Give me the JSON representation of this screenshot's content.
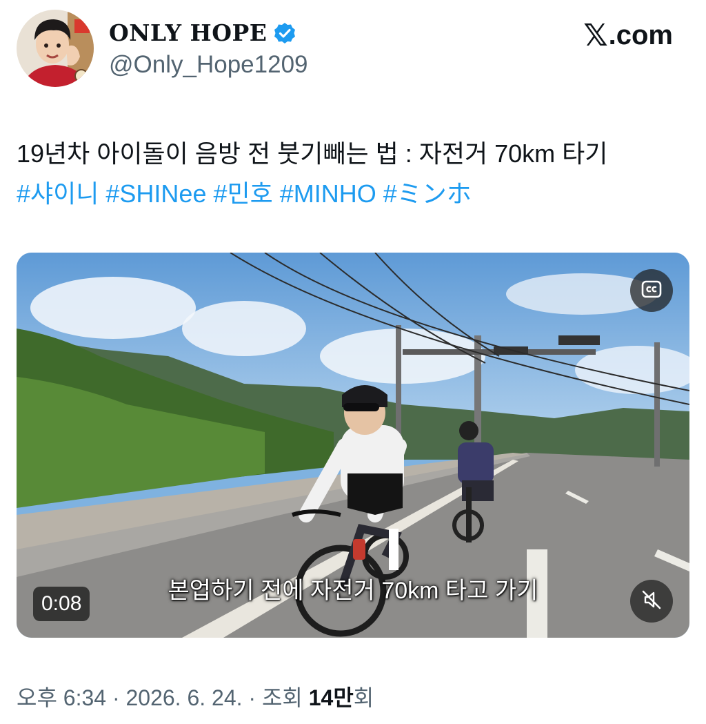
{
  "author": {
    "display_name": "ONLY HOPE",
    "handle": "@Only_Hope1209",
    "avatar_icon": "profile-avatar",
    "verified_icon": "verified-badge-icon"
  },
  "brand": {
    "label": ".com",
    "x_glyph": "𝕏"
  },
  "tweet": {
    "text": "19년차 아이돌이 음방 전 붓기빼는 법 : 자전거 70km 타기",
    "hashtags": [
      "#샤이니",
      "#SHINee",
      "#민호",
      "#MINHO",
      "#ミンホ"
    ]
  },
  "video": {
    "subtitle": "본업하기 전에 자전거 70km 타고 가기",
    "timestamp": "0:08",
    "cc_icon": "closed-captions-icon",
    "mute_icon": "muted-speaker-icon"
  },
  "meta": {
    "prefix": "오후 6:34 · 2026. 6. 24. · 조회 ",
    "views_bold": "14만",
    "views_suffix": "회"
  },
  "colors": {
    "link": "#1d9bf0",
    "secondary_text": "#536471",
    "primary_text": "#0f1419"
  }
}
